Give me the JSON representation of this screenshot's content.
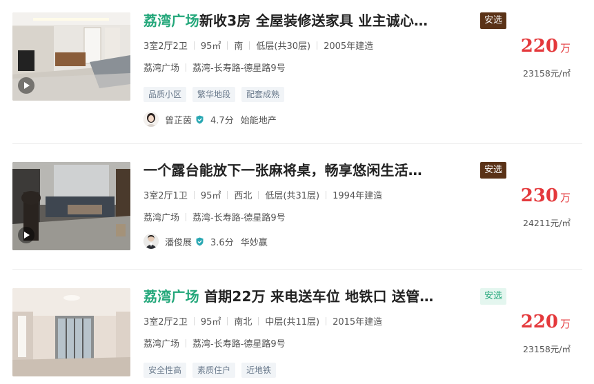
{
  "listings": [
    {
      "title_highlight": "荔湾广场",
      "title_rest": "新收3房 全屋装修送家具 业主诚心…",
      "badge": "安选",
      "badge_style": "dark",
      "layout": "3室2厅2卫",
      "area": "95㎡",
      "orientation": "南",
      "floor": "低层(共30层)",
      "built": "2005年建造",
      "community": "荔湾广场",
      "address": "荔湾-长寿路-德星路9号",
      "tags": [
        "品质小区",
        "繁华地段",
        "配套成熟"
      ],
      "agent_name": "曾芷茵",
      "agent_score": "4.7分",
      "agency": "始能地产",
      "price": "220",
      "price_unit": "万",
      "unit_price": "23158元/㎡",
      "has_video": true
    },
    {
      "title_highlight": "",
      "title_rest": "一个露台能放下一张麻将桌，畅享悠闲生活…",
      "badge": "安选",
      "badge_style": "dark",
      "layout": "3室2厅1卫",
      "area": "95㎡",
      "orientation": "西北",
      "floor": "低层(共31层)",
      "built": "1994年建造",
      "community": "荔湾广场",
      "address": "荔湾-长寿路-德星路9号",
      "tags": [],
      "agent_name": "潘俊展",
      "agent_score": "3.6分",
      "agency": "华妙赢",
      "price": "230",
      "price_unit": "万",
      "unit_price": "24211元/㎡",
      "has_video": true
    },
    {
      "title_highlight": "荔湾广场",
      "title_rest": " 首期22万 来电送车位 地铁口 送管…",
      "badge": "安选",
      "badge_style": "light",
      "layout": "3室2厅2卫",
      "area": "95㎡",
      "orientation": "南北",
      "floor": "中层(共11层)",
      "built": "2015年建造",
      "community": "荔湾广场",
      "address": "荔湾-长寿路-德星路9号",
      "tags": [
        "安全性高",
        "素质住户",
        "近地铁"
      ],
      "agent_name": "",
      "agent_score": "",
      "agency": "",
      "price": "220",
      "price_unit": "万",
      "unit_price": "23158元/㎡",
      "has_video": false
    }
  ],
  "icons": {
    "play": "play-icon",
    "verified": "shield-icon"
  },
  "colors": {
    "highlight_green": "#23a77a",
    "price_red": "#e4393c",
    "badge_dark": "#5a3217",
    "badge_light_bg": "#e4f6ef"
  }
}
